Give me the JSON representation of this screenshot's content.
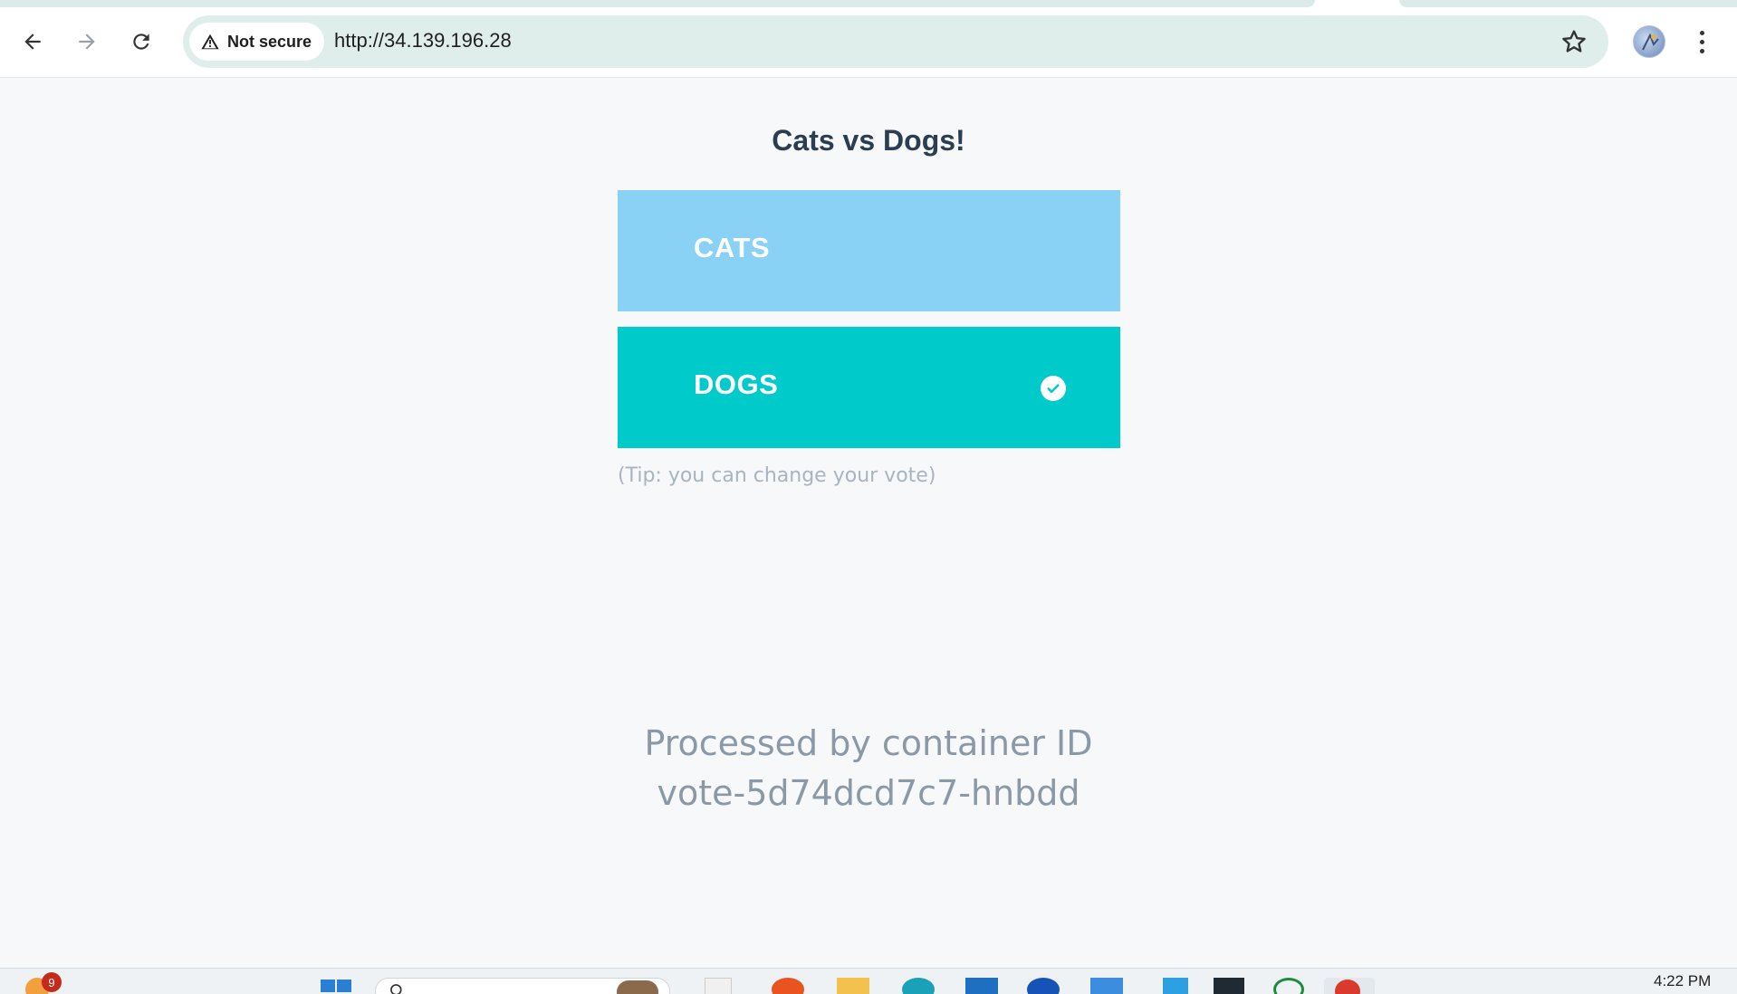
{
  "browser": {
    "security_label": "Not secure",
    "url": "http://34.139.196.28"
  },
  "page": {
    "title": "Cats vs Dogs!",
    "options": [
      {
        "label": "CATS",
        "selected": false,
        "color": "#8ad1f6"
      },
      {
        "label": "DOGS",
        "selected": true,
        "color": "#00cbca"
      }
    ],
    "tip": "(Tip: you can change your vote)",
    "processed_line1": "Processed by container ID",
    "processed_line2": "vote-5d74dcd7c7-hnbdd"
  },
  "taskbar": {
    "notification_count": "9",
    "time": "4:22 PM"
  }
}
